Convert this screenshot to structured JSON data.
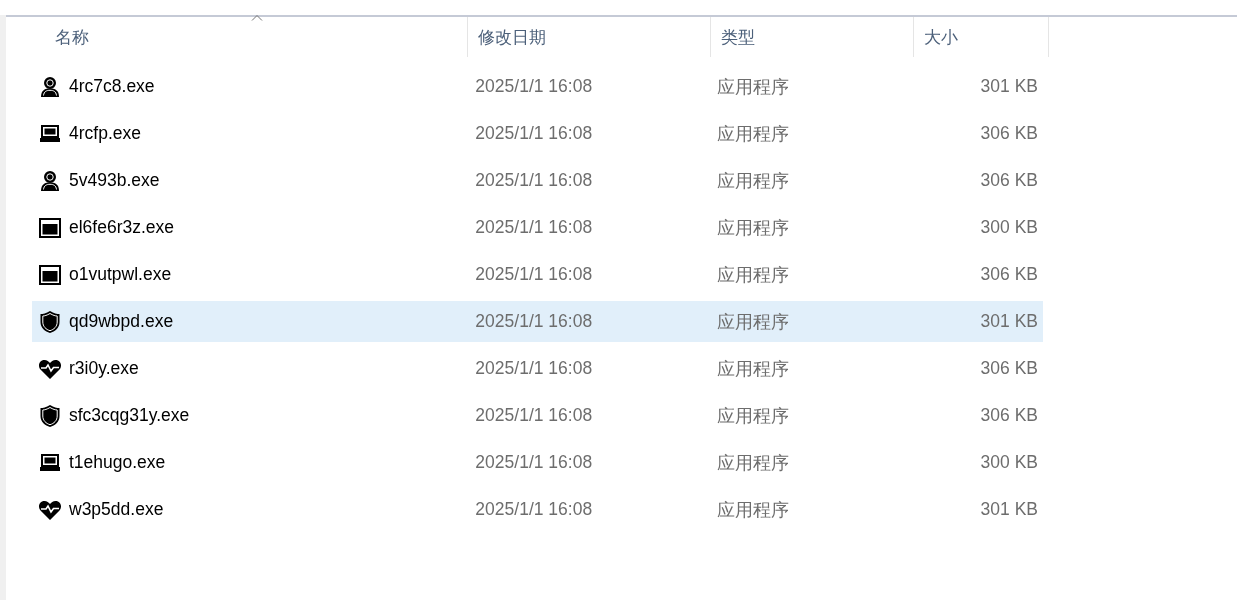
{
  "columns": [
    {
      "label": "名称",
      "sorted": true
    },
    {
      "label": "修改日期",
      "sorted": false
    },
    {
      "label": "类型",
      "sorted": false
    },
    {
      "label": "大小",
      "sorted": false
    }
  ],
  "files": [
    {
      "name": "4rc7c8.exe",
      "kind": "person",
      "modified": "2025/1/1 16:08",
      "type": "应用程序",
      "size": "301 KB",
      "selected": false
    },
    {
      "name": "4rcfp.exe",
      "kind": "laptop",
      "modified": "2025/1/1 16:08",
      "type": "应用程序",
      "size": "306 KB",
      "selected": false
    },
    {
      "name": "5v493b.exe",
      "kind": "person",
      "modified": "2025/1/1 16:08",
      "type": "应用程序",
      "size": "306 KB",
      "selected": false
    },
    {
      "name": "el6fe6r3z.exe",
      "kind": "window",
      "modified": "2025/1/1 16:08",
      "type": "应用程序",
      "size": "300 KB",
      "selected": false
    },
    {
      "name": "o1vutpwl.exe",
      "kind": "window",
      "modified": "2025/1/1 16:08",
      "type": "应用程序",
      "size": "306 KB",
      "selected": false
    },
    {
      "name": "qd9wbpd.exe",
      "kind": "shield",
      "modified": "2025/1/1 16:08",
      "type": "应用程序",
      "size": "301 KB",
      "selected": true
    },
    {
      "name": "r3i0y.exe",
      "kind": "heart",
      "modified": "2025/1/1 16:08",
      "type": "应用程序",
      "size": "306 KB",
      "selected": false
    },
    {
      "name": "sfc3cqg31y.exe",
      "kind": "shield",
      "modified": "2025/1/1 16:08",
      "type": "应用程序",
      "size": "306 KB",
      "selected": false
    },
    {
      "name": "t1ehugo.exe",
      "kind": "laptop",
      "modified": "2025/1/1 16:08",
      "type": "应用程序",
      "size": "300 KB",
      "selected": false
    },
    {
      "name": "w3p5dd.exe",
      "kind": "heart",
      "modified": "2025/1/1 16:08",
      "type": "应用程序",
      "size": "301 KB",
      "selected": false
    }
  ]
}
